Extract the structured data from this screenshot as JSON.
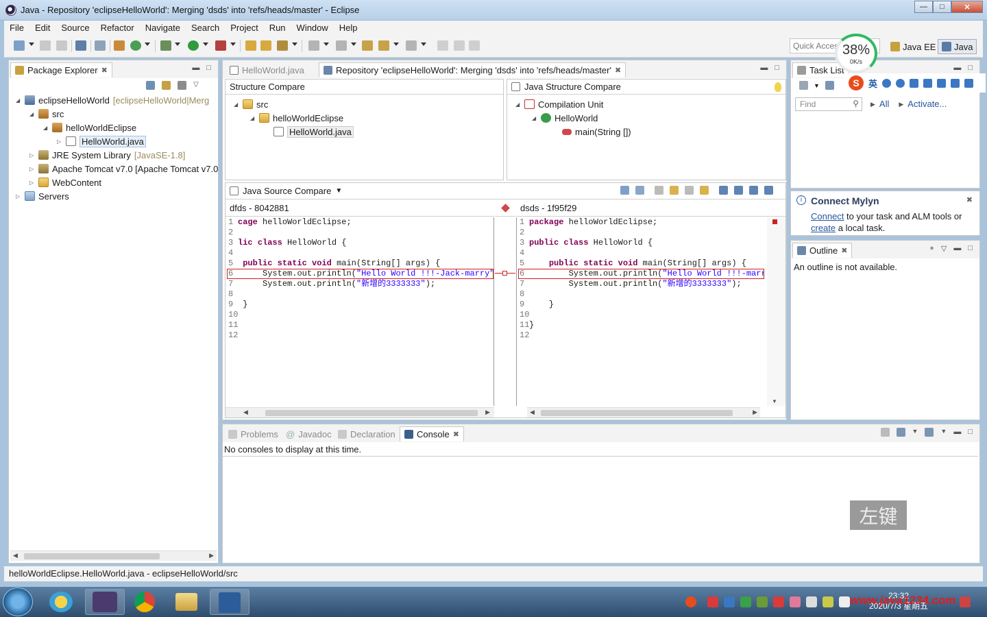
{
  "window": {
    "title": "Java - Repository 'eclipseHelloWorld': Merging 'dsds' into 'refs/heads/master' - Eclipse"
  },
  "menu": [
    "File",
    "Edit",
    "Source",
    "Refactor",
    "Navigate",
    "Search",
    "Project",
    "Run",
    "Window",
    "Help"
  ],
  "toolbar": {
    "quick_access_placeholder": "Quick Access",
    "perf_percent": "38%",
    "perf_net": "0K/s",
    "perspectives": [
      "Java EE",
      "Java"
    ]
  },
  "package_explorer": {
    "tab": "Package Explorer",
    "items": [
      {
        "label": "eclipseHelloWorld",
        "decor": "[eclipseHelloWorld|Merg"
      },
      {
        "label": "src"
      },
      {
        "label": "helloWorldEclipse"
      },
      {
        "label": "HelloWorld.java"
      },
      {
        "label": "JRE System Library",
        "decor": "[JavaSE-1.8]"
      },
      {
        "label": "Apache Tomcat v7.0 [Apache Tomcat v7.0"
      },
      {
        "label": "WebContent"
      },
      {
        "label": "Servers"
      }
    ]
  },
  "editor": {
    "tabs": [
      "HelloWorld.java",
      "Repository 'eclipseHelloWorld': Merging 'dsds' into 'refs/heads/master'"
    ],
    "structure_compare": {
      "title": "Structure Compare",
      "items": [
        "src",
        "helloWorldEclipse",
        "HelloWorld.java"
      ]
    },
    "java_structure_compare": {
      "title": "Java Structure Compare",
      "items": [
        "Compilation Unit",
        "HelloWorld",
        "main(String [])"
      ]
    },
    "source_compare": {
      "title": "Java Source Compare",
      "left_header": "dfds - 8042881",
      "right_header": "dsds - 1f95f29",
      "left_lines": [
        {
          "n": "1",
          "code": "cage helloWorldEclipse;"
        },
        {
          "n": "2",
          "code": ""
        },
        {
          "n": "3",
          "code": "lic class HelloWorld {"
        },
        {
          "n": "4",
          "code": ""
        },
        {
          "n": "5",
          "code": " public static void main(String[] args) {"
        },
        {
          "n": "6",
          "code": "     System.out.println(\"Hello World !!!-Jack-marry\")"
        },
        {
          "n": "7",
          "code": "     System.out.println(\"新增的3333333\");"
        },
        {
          "n": "8",
          "code": ""
        },
        {
          "n": "9",
          "code": " }"
        },
        {
          "n": "10",
          "code": ""
        },
        {
          "n": "11",
          "code": ""
        },
        {
          "n": "12",
          "code": ""
        }
      ],
      "right_lines": [
        {
          "n": "1",
          "code": "package helloWorldEclipse;"
        },
        {
          "n": "2",
          "code": ""
        },
        {
          "n": "3",
          "code": "public class HelloWorld {"
        },
        {
          "n": "4",
          "code": ""
        },
        {
          "n": "5",
          "code": "    public static void main(String[] args) {"
        },
        {
          "n": "6",
          "code": "        System.out.println(\"Hello World !!!-marry"
        },
        {
          "n": "7",
          "code": "        System.out.println(\"新增的3333333\");"
        },
        {
          "n": "8",
          "code": ""
        },
        {
          "n": "9",
          "code": "    }"
        },
        {
          "n": "10",
          "code": ""
        },
        {
          "n": "11",
          "code": "}"
        },
        {
          "n": "12",
          "code": ""
        }
      ]
    }
  },
  "task_list": {
    "tab": "Task List",
    "find_placeholder": "Find",
    "all_label": "All",
    "activate_label": "Activate..."
  },
  "mylyn": {
    "title": "Connect Mylyn",
    "connect_link": "Connect",
    "text1": " to your task and ALM tools or",
    "create_link": "create",
    "text2": " a local task."
  },
  "outline": {
    "tab": "Outline",
    "message": "An outline is not available."
  },
  "bottom": {
    "tabs": [
      "Problems",
      "Javadoc",
      "Declaration",
      "Console"
    ],
    "message": "No consoles to display at this time."
  },
  "status": {
    "text": "helloWorldEclipse.HelloWorld.java - eclipseHelloWorld/src"
  },
  "overlay": {
    "watermark": "左键",
    "site": "www.java1234.com"
  },
  "taskbar": {
    "time": "23:32",
    "date": "2020/7/3 星期五"
  },
  "colors": {
    "accent": "#2fba62",
    "diff_red": "#d02020",
    "keyword": "#7f0055",
    "string": "#2a00ff"
  }
}
